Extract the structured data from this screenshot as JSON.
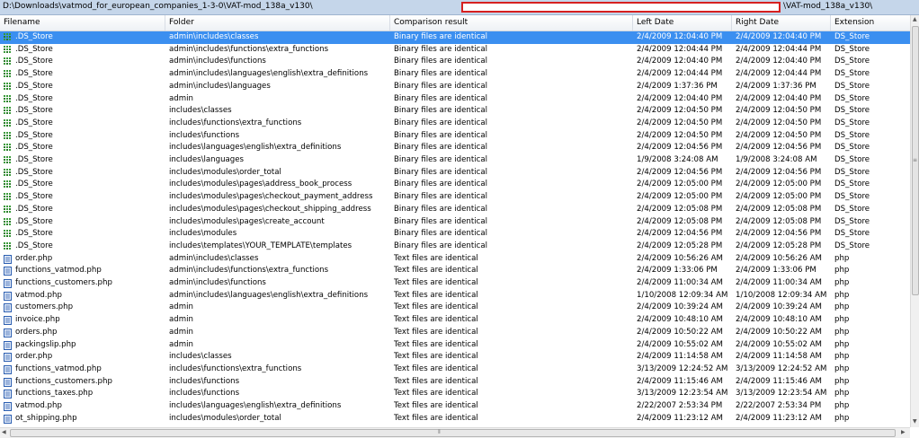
{
  "paths": {
    "left": "D:\\Downloads\\vatmod_for_european_companies_1-3-0\\VAT-mod_138a_v130\\",
    "right": "\\VAT-mod_138a_v130\\"
  },
  "columns": {
    "filename": "Filename",
    "folder": "Folder",
    "comparison": "Comparison result",
    "left_date": "Left Date",
    "right_date": "Right Date",
    "extension": "Extension"
  },
  "rows": [
    {
      "icon": "binary-file-icon",
      "name": ".DS_Store",
      "folder": "admin\\includes\\classes",
      "result": "Binary files are identical",
      "left": "2/4/2009 12:04:40 PM",
      "right": "2/4/2009 12:04:40 PM",
      "ext": "DS_Store"
    },
    {
      "icon": "binary-file-icon",
      "name": ".DS_Store",
      "folder": "admin\\includes\\functions\\extra_functions",
      "result": "Binary files are identical",
      "left": "2/4/2009 12:04:44 PM",
      "right": "2/4/2009 12:04:44 PM",
      "ext": "DS_Store"
    },
    {
      "icon": "binary-file-icon",
      "name": ".DS_Store",
      "folder": "admin\\includes\\functions",
      "result": "Binary files are identical",
      "left": "2/4/2009 12:04:40 PM",
      "right": "2/4/2009 12:04:40 PM",
      "ext": "DS_Store"
    },
    {
      "icon": "binary-file-icon",
      "name": ".DS_Store",
      "folder": "admin\\includes\\languages\\english\\extra_definitions",
      "result": "Binary files are identical",
      "left": "2/4/2009 12:04:44 PM",
      "right": "2/4/2009 12:04:44 PM",
      "ext": "DS_Store"
    },
    {
      "icon": "binary-file-icon",
      "name": ".DS_Store",
      "folder": "admin\\includes\\languages",
      "result": "Binary files are identical",
      "left": "2/4/2009 1:37:36 PM",
      "right": "2/4/2009 1:37:36 PM",
      "ext": "DS_Store"
    },
    {
      "icon": "binary-file-icon",
      "name": ".DS_Store",
      "folder": "admin",
      "result": "Binary files are identical",
      "left": "2/4/2009 12:04:40 PM",
      "right": "2/4/2009 12:04:40 PM",
      "ext": "DS_Store"
    },
    {
      "icon": "binary-file-icon",
      "name": ".DS_Store",
      "folder": "includes\\classes",
      "result": "Binary files are identical",
      "left": "2/4/2009 12:04:50 PM",
      "right": "2/4/2009 12:04:50 PM",
      "ext": "DS_Store"
    },
    {
      "icon": "binary-file-icon",
      "name": ".DS_Store",
      "folder": "includes\\functions\\extra_functions",
      "result": "Binary files are identical",
      "left": "2/4/2009 12:04:50 PM",
      "right": "2/4/2009 12:04:50 PM",
      "ext": "DS_Store"
    },
    {
      "icon": "binary-file-icon",
      "name": ".DS_Store",
      "folder": "includes\\functions",
      "result": "Binary files are identical",
      "left": "2/4/2009 12:04:50 PM",
      "right": "2/4/2009 12:04:50 PM",
      "ext": "DS_Store"
    },
    {
      "icon": "binary-file-icon",
      "name": ".DS_Store",
      "folder": "includes\\languages\\english\\extra_definitions",
      "result": "Binary files are identical",
      "left": "2/4/2009 12:04:56 PM",
      "right": "2/4/2009 12:04:56 PM",
      "ext": "DS_Store"
    },
    {
      "icon": "binary-file-icon",
      "name": ".DS_Store",
      "folder": "includes\\languages",
      "result": "Binary files are identical",
      "left": "1/9/2008 3:24:08 AM",
      "right": "1/9/2008 3:24:08 AM",
      "ext": "DS_Store"
    },
    {
      "icon": "binary-file-icon",
      "name": ".DS_Store",
      "folder": "includes\\modules\\order_total",
      "result": "Binary files are identical",
      "left": "2/4/2009 12:04:56 PM",
      "right": "2/4/2009 12:04:56 PM",
      "ext": "DS_Store"
    },
    {
      "icon": "binary-file-icon",
      "name": ".DS_Store",
      "folder": "includes\\modules\\pages\\address_book_process",
      "result": "Binary files are identical",
      "left": "2/4/2009 12:05:00 PM",
      "right": "2/4/2009 12:05:00 PM",
      "ext": "DS_Store"
    },
    {
      "icon": "binary-file-icon",
      "name": ".DS_Store",
      "folder": "includes\\modules\\pages\\checkout_payment_address",
      "result": "Binary files are identical",
      "left": "2/4/2009 12:05:00 PM",
      "right": "2/4/2009 12:05:00 PM",
      "ext": "DS_Store"
    },
    {
      "icon": "binary-file-icon",
      "name": ".DS_Store",
      "folder": "includes\\modules\\pages\\checkout_shipping_address",
      "result": "Binary files are identical",
      "left": "2/4/2009 12:05:08 PM",
      "right": "2/4/2009 12:05:08 PM",
      "ext": "DS_Store"
    },
    {
      "icon": "binary-file-icon",
      "name": ".DS_Store",
      "folder": "includes\\modules\\pages\\create_account",
      "result": "Binary files are identical",
      "left": "2/4/2009 12:05:08 PM",
      "right": "2/4/2009 12:05:08 PM",
      "ext": "DS_Store"
    },
    {
      "icon": "binary-file-icon",
      "name": ".DS_Store",
      "folder": "includes\\modules",
      "result": "Binary files are identical",
      "left": "2/4/2009 12:04:56 PM",
      "right": "2/4/2009 12:04:56 PM",
      "ext": "DS_Store"
    },
    {
      "icon": "binary-file-icon",
      "name": ".DS_Store",
      "folder": "includes\\templates\\YOUR_TEMPLATE\\templates",
      "result": "Binary files are identical",
      "left": "2/4/2009 12:05:28 PM",
      "right": "2/4/2009 12:05:28 PM",
      "ext": "DS_Store"
    },
    {
      "icon": "text-file-icon",
      "name": "order.php",
      "folder": "admin\\includes\\classes",
      "result": "Text files are identical",
      "left": "2/4/2009 10:56:26 AM",
      "right": "2/4/2009 10:56:26 AM",
      "ext": "php"
    },
    {
      "icon": "text-file-icon",
      "name": "functions_vatmod.php",
      "folder": "admin\\includes\\functions\\extra_functions",
      "result": "Text files are identical",
      "left": "2/4/2009 1:33:06 PM",
      "right": "2/4/2009 1:33:06 PM",
      "ext": "php"
    },
    {
      "icon": "text-file-icon",
      "name": "functions_customers.php",
      "folder": "admin\\includes\\functions",
      "result": "Text files are identical",
      "left": "2/4/2009 11:00:34 AM",
      "right": "2/4/2009 11:00:34 AM",
      "ext": "php"
    },
    {
      "icon": "text-file-icon",
      "name": "vatmod.php",
      "folder": "admin\\includes\\languages\\english\\extra_definitions",
      "result": "Text files are identical",
      "left": "1/10/2008 12:09:34 AM",
      "right": "1/10/2008 12:09:34 AM",
      "ext": "php"
    },
    {
      "icon": "text-file-icon",
      "name": "customers.php",
      "folder": "admin",
      "result": "Text files are identical",
      "left": "2/4/2009 10:39:24 AM",
      "right": "2/4/2009 10:39:24 AM",
      "ext": "php"
    },
    {
      "icon": "text-file-icon",
      "name": "invoice.php",
      "folder": "admin",
      "result": "Text files are identical",
      "left": "2/4/2009 10:48:10 AM",
      "right": "2/4/2009 10:48:10 AM",
      "ext": "php"
    },
    {
      "icon": "text-file-icon",
      "name": "orders.php",
      "folder": "admin",
      "result": "Text files are identical",
      "left": "2/4/2009 10:50:22 AM",
      "right": "2/4/2009 10:50:22 AM",
      "ext": "php"
    },
    {
      "icon": "text-file-icon",
      "name": "packingslip.php",
      "folder": "admin",
      "result": "Text files are identical",
      "left": "2/4/2009 10:55:02 AM",
      "right": "2/4/2009 10:55:02 AM",
      "ext": "php"
    },
    {
      "icon": "text-file-icon",
      "name": "order.php",
      "folder": "includes\\classes",
      "result": "Text files are identical",
      "left": "2/4/2009 11:14:58 AM",
      "right": "2/4/2009 11:14:58 AM",
      "ext": "php"
    },
    {
      "icon": "text-file-icon",
      "name": "functions_vatmod.php",
      "folder": "includes\\functions\\extra_functions",
      "result": "Text files are identical",
      "left": "3/13/2009 12:24:52 AM",
      "right": "3/13/2009 12:24:52 AM",
      "ext": "php"
    },
    {
      "icon": "text-file-icon",
      "name": "functions_customers.php",
      "folder": "includes\\functions",
      "result": "Text files are identical",
      "left": "2/4/2009 11:15:46 AM",
      "right": "2/4/2009 11:15:46 AM",
      "ext": "php"
    },
    {
      "icon": "text-file-icon",
      "name": "functions_taxes.php",
      "folder": "includes\\functions",
      "result": "Text files are identical",
      "left": "3/13/2009 12:23:54 AM",
      "right": "3/13/2009 12:23:54 AM",
      "ext": "php"
    },
    {
      "icon": "text-file-icon",
      "name": "vatmod.php",
      "folder": "includes\\languages\\english\\extra_definitions",
      "result": "Text files are identical",
      "left": "2/22/2007 2:53:34 PM",
      "right": "2/22/2007 2:53:34 PM",
      "ext": "php"
    },
    {
      "icon": "text-file-icon",
      "name": "ot_shipping.php",
      "folder": "includes\\modules\\order_total",
      "result": "Text files are identical",
      "left": "2/4/2009 11:23:12 AM",
      "right": "2/4/2009 11:23:12 AM",
      "ext": "php"
    }
  ],
  "selected_row": 0,
  "colors": {
    "selection": "#3b8ff0",
    "path_bar": "#c5d6ea",
    "filter_border": "#d62020",
    "binary_icon": "#3a9a3a",
    "text_icon": "#2a5db0"
  }
}
